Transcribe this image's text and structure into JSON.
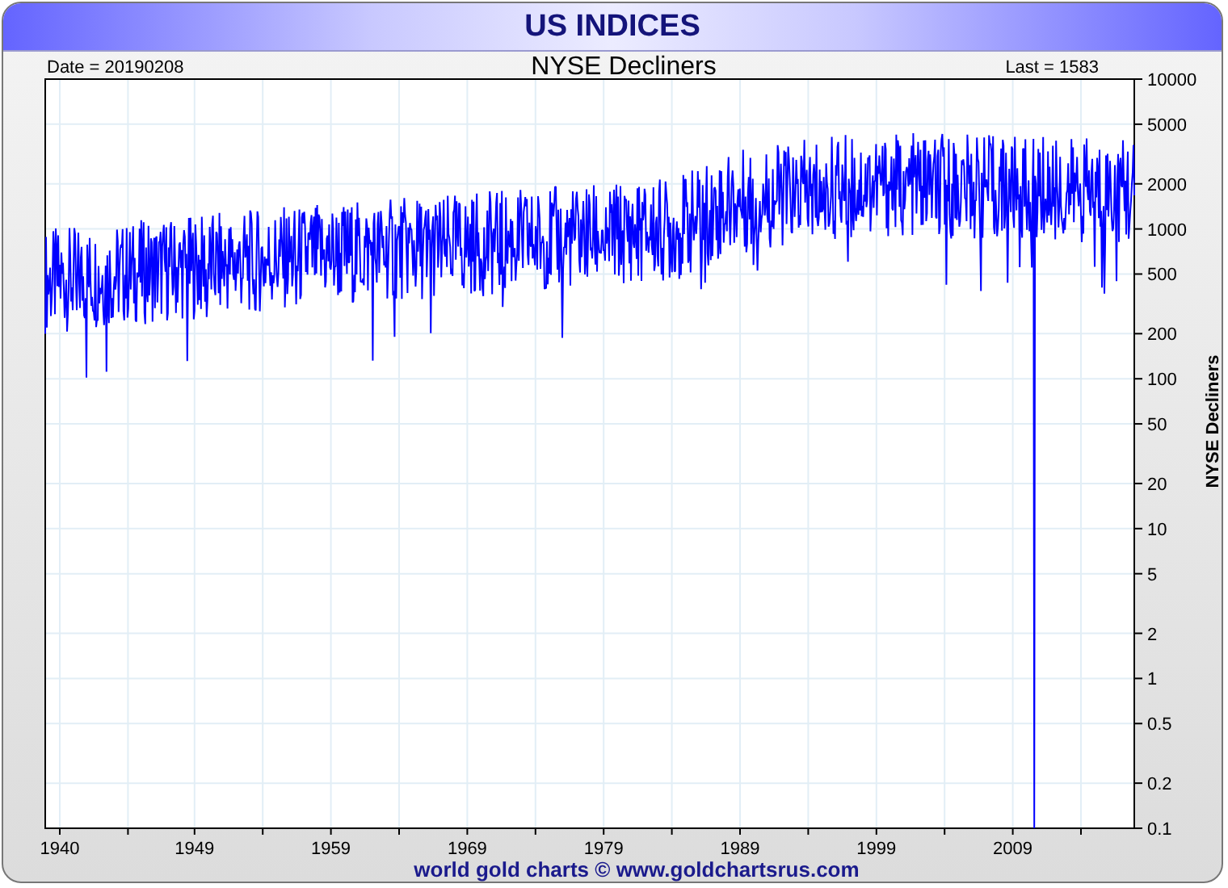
{
  "header": {
    "title": "US INDICES"
  },
  "chart": {
    "date_label": "Date = 20190208",
    "title": "NYSE Decliners",
    "last_label": "Last = 1583",
    "ylabel": "NYSE Decliners",
    "y_ticks": [
      "10000",
      "5000",
      "2000",
      "1000",
      "500",
      "200",
      "100",
      "50",
      "20",
      "10",
      "5",
      "2",
      "1",
      "0.5",
      "0.2",
      "0.1"
    ],
    "x_ticks": [
      "1940",
      "1949",
      "1959",
      "1969",
      "1979",
      "1989",
      "1999",
      "2009"
    ]
  },
  "footer": {
    "credit": "world gold charts © www.goldchartsrus.com"
  }
}
